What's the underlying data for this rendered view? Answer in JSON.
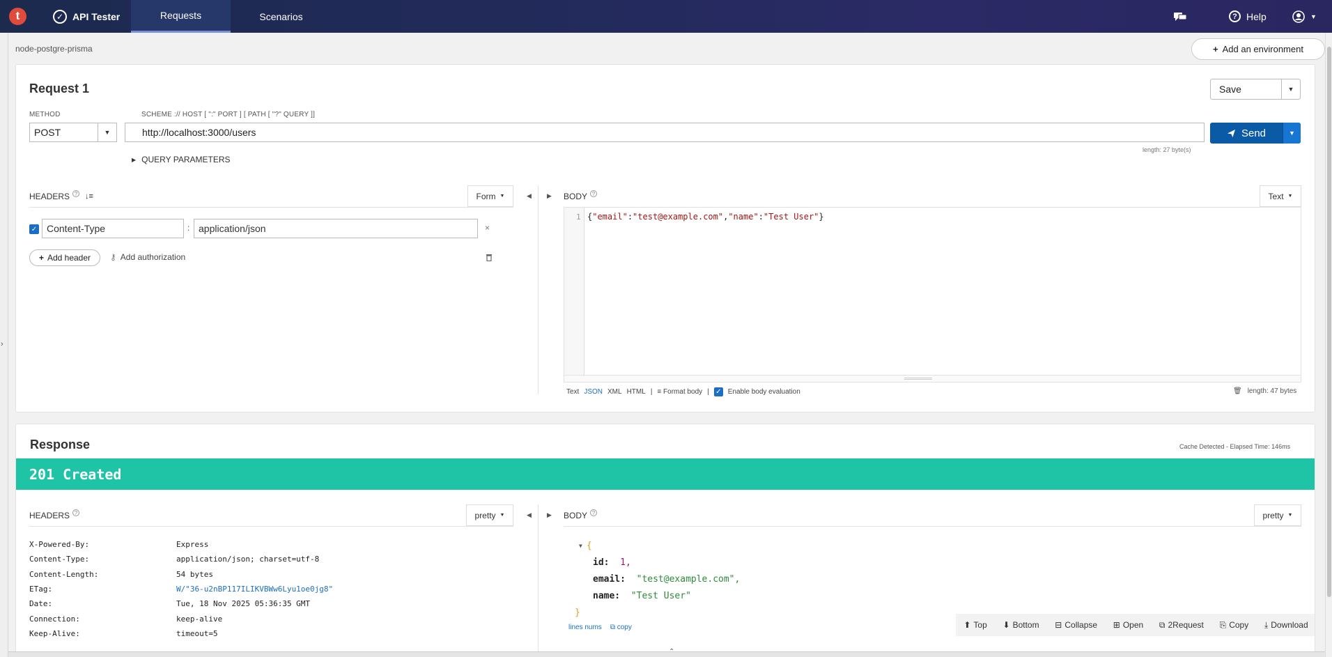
{
  "nav": {
    "logo_letter": "t",
    "app_name": "API Tester",
    "tabs": [
      {
        "label": "Requests",
        "active": true
      },
      {
        "label": "Scenarios",
        "active": false
      }
    ],
    "help_label": "Help"
  },
  "project": "node-postgre-prisma",
  "add_environment_label": "Add an environment",
  "request": {
    "title": "Request 1",
    "method_label": "METHOD",
    "method": "POST",
    "url_hint": "SCHEME :// HOST [ \":\" PORT ] [ PATH [ \"?\" QUERY ]]",
    "url": "http://localhost:3000/users",
    "url_length": "length: 27 byte(s)",
    "save_label": "Save",
    "send_label": "Send",
    "query_params_label": "QUERY PARAMETERS",
    "headers_label": "HEADERS",
    "headers_mode": "Form",
    "headers": [
      {
        "name": "Content-Type",
        "value": "application/json",
        "enabled": true
      }
    ],
    "add_header_label": "Add header",
    "add_auth_label": "Add authorization",
    "body_label": "BODY",
    "body_mode": "Text",
    "body_line_number": "1",
    "body_parts": {
      "open": "{",
      "k1": "\"email\"",
      "colon": ":",
      "v1": "\"test@example.com\"",
      "comma": ",",
      "k2": "\"name\"",
      "v2": "\"Test User\"",
      "close": "}"
    },
    "body_formats": [
      "Text",
      "JSON",
      "XML",
      "HTML"
    ],
    "body_format_active": "JSON",
    "separator": "|",
    "format_body_label": "Format body",
    "enable_eval_label": "Enable body evaluation",
    "body_length": "length: 47 bytes"
  },
  "response": {
    "title": "Response",
    "cache_info": "Cache Detected - Elapsed Time: 146ms",
    "status": "201 Created",
    "headers_label": "HEADERS",
    "headers_view": "pretty",
    "headers": [
      {
        "key": "X-Powered-By:",
        "value": "Express",
        "link": false
      },
      {
        "key": "Content-Type:",
        "value": "application/json; charset=utf-8",
        "link": false
      },
      {
        "key": "Content-Length:",
        "value": "54 bytes",
        "link": false
      },
      {
        "key": "ETag:",
        "value": "W/\"36-u2nBP117ILIKVBWw6Lyu1oe0jg8\"",
        "link": true
      },
      {
        "key": "Date:",
        "value": "Tue, 18 Nov 2025 05:36:35 GMT",
        "link": false
      },
      {
        "key": "Connection:",
        "value": "keep-alive",
        "link": false
      },
      {
        "key": "Keep-Alive:",
        "value": "timeout=5",
        "link": false
      }
    ],
    "body_label": "BODY",
    "body_view": "pretty",
    "json": {
      "open": "{",
      "k_id": "id:",
      "v_id": "1,",
      "k_email": "email:",
      "v_email": "\"test@example.com\",",
      "k_name": "name:",
      "v_name": "\"Test User\"",
      "close": "}"
    },
    "lines_nums_label": "lines nums",
    "copy_label": "copy",
    "toolbar": [
      "Top",
      "Bottom",
      "Collapse",
      "Open",
      "2Request",
      "Copy",
      "Download"
    ]
  }
}
